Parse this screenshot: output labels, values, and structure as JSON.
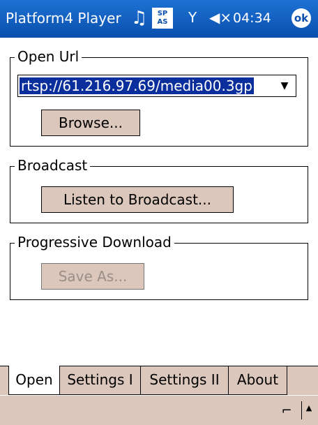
{
  "titlebar": {
    "app_title": "Platform4 Player",
    "sp_icon_text": "SP\nAS",
    "clock": "04:34",
    "ok_label": "ok"
  },
  "open_url": {
    "legend": "Open Url",
    "url_value": "rtsp://61.216.97.69/media00.3gp",
    "browse_label": "Browse..."
  },
  "broadcast": {
    "legend": "Broadcast",
    "listen_label": "Listen to Broadcast..."
  },
  "progressive": {
    "legend": "Progressive Download",
    "save_label": "Save As..."
  },
  "tabs": [
    "Open",
    "Settings I",
    "Settings II",
    "About"
  ],
  "active_tab": "Open",
  "icons": {
    "music": "music-icon",
    "sp": "sp-icon",
    "signal": "signal-icon",
    "speaker": "speaker-muted-icon",
    "sip": "keyboard-icon",
    "sip_arrow": "up-arrow-icon"
  },
  "colors": {
    "title_bar": "#0a4fae",
    "button_face": "#dbc7bb",
    "selection": "#0a2e9c"
  }
}
